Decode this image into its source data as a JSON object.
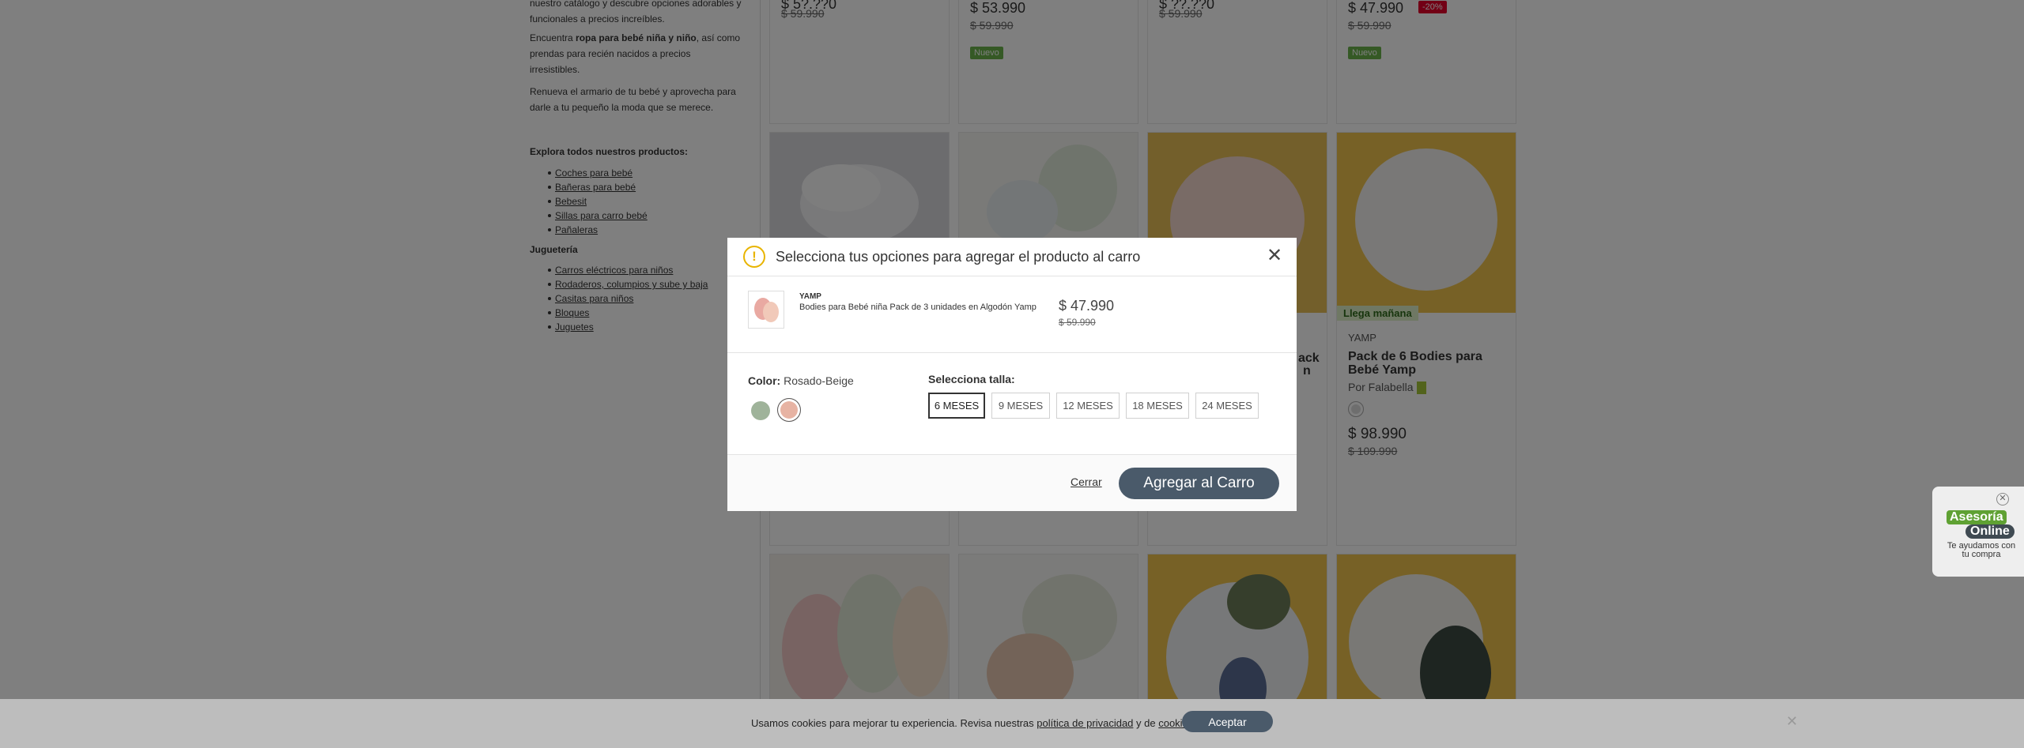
{
  "sidebar": {
    "intro1": "nuestro catálogo y descubre opciones adorables y funcionales a precios increíbles.",
    "intro2_pre": "Encuentra ",
    "intro2_bold": "ropa para bebé niña y niño",
    "intro2_post": ", así como prendas para recién nacidos a precios irresistibles.",
    "intro3": "Renueva el armario de tu bebé y aprovecha para darle a tu pequeño la moda que se merece.",
    "explore_title": "Explora todos nuestros productos:",
    "explore_links": [
      "Coches para bebé",
      "Bañeras para bebé",
      "Bebesit",
      "Sillas para carro bebé",
      "Pañaleras"
    ],
    "toys_title": "Juguetería",
    "toys_links": [
      "Carros eléctricos para niños",
      "Rodaderos, columpios y sube y baja",
      "Casitas para niños",
      "Bloques",
      "Juguetes"
    ]
  },
  "grid": {
    "row1": [
      {
        "price": "$ 5?.??0",
        "old": "$ 59.990"
      },
      {
        "price": "$ 53.990",
        "old": "$ 59.990",
        "badge": "Nuevo"
      },
      {
        "price": "$ ??.??0",
        "old": "$ 59.990"
      },
      {
        "price": "$ 47.990",
        "old": "$ 59.990",
        "badge": "Nuevo",
        "discount": "-20%"
      }
    ],
    "row2_card3": {
      "title_partial": "ack",
      "title_partial2": "n"
    },
    "row2_card4": {
      "delivery": "Llega mañana",
      "brand": "YAMP",
      "title": "Pack de 6 Bodies para Bebé Yamp",
      "seller": "Por Falabella",
      "price": "$ 98.990",
      "old": "$ 109.990"
    }
  },
  "modal": {
    "title": "Selecciona tus opciones para agregar el producto al carro",
    "product": {
      "brand": "YAMP",
      "name": "Bodies para Bebé niña Pack de 3 unidades en Algodón Yamp",
      "price": "$ 47.990",
      "old_price": "$ 59.990"
    },
    "color_label": "Color:",
    "color_value": "Rosado-Beige",
    "colors": [
      "#9fb39a",
      "#e7b3a3"
    ],
    "selected_color_index": 1,
    "size_label": "Selecciona talla:",
    "sizes": [
      "6 MESES",
      "9 MESES",
      "12 MESES",
      "18 MESES",
      "24 MESES"
    ],
    "selected_size": "6 MESES",
    "close_label": "Cerrar",
    "add_label": "Agregar al Carro"
  },
  "cookie": {
    "text_pre": "Usamos cookies para mejorar tu experiencia. Revisa nuestras ",
    "privacy": "política de privacidad",
    "mid": " y de ",
    "cookies": "cookies",
    "end": ".",
    "accept": "Aceptar"
  },
  "chat": {
    "line1": "Asesoría",
    "line2": "Online",
    "sub": "Te ayudamos con tu compra"
  }
}
